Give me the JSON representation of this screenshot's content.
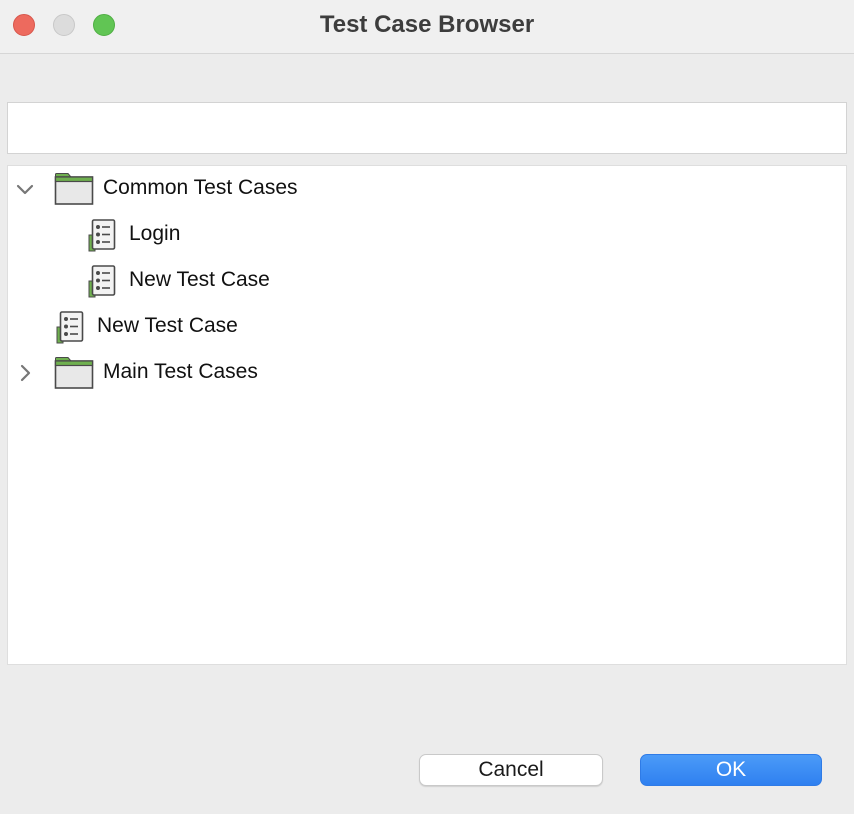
{
  "window": {
    "title": "Test Case Browser"
  },
  "search": {
    "value": "",
    "placeholder": ""
  },
  "tree": {
    "items": [
      {
        "label": "Common Test Cases",
        "type": "folder",
        "expanded": true
      },
      {
        "label": "Login",
        "type": "test-case"
      },
      {
        "label": "New Test Case",
        "type": "test-case"
      },
      {
        "label": "New Test Case",
        "type": "test-case"
      },
      {
        "label": "Main Test Cases",
        "type": "folder",
        "expanded": false
      }
    ]
  },
  "buttons": {
    "cancel_label": "Cancel",
    "ok_label": "OK"
  },
  "colors": {
    "accent": "#3a8bf5",
    "folder_tab": "#6fb04f",
    "close": "#ed6a5e",
    "maximize": "#61c554"
  }
}
